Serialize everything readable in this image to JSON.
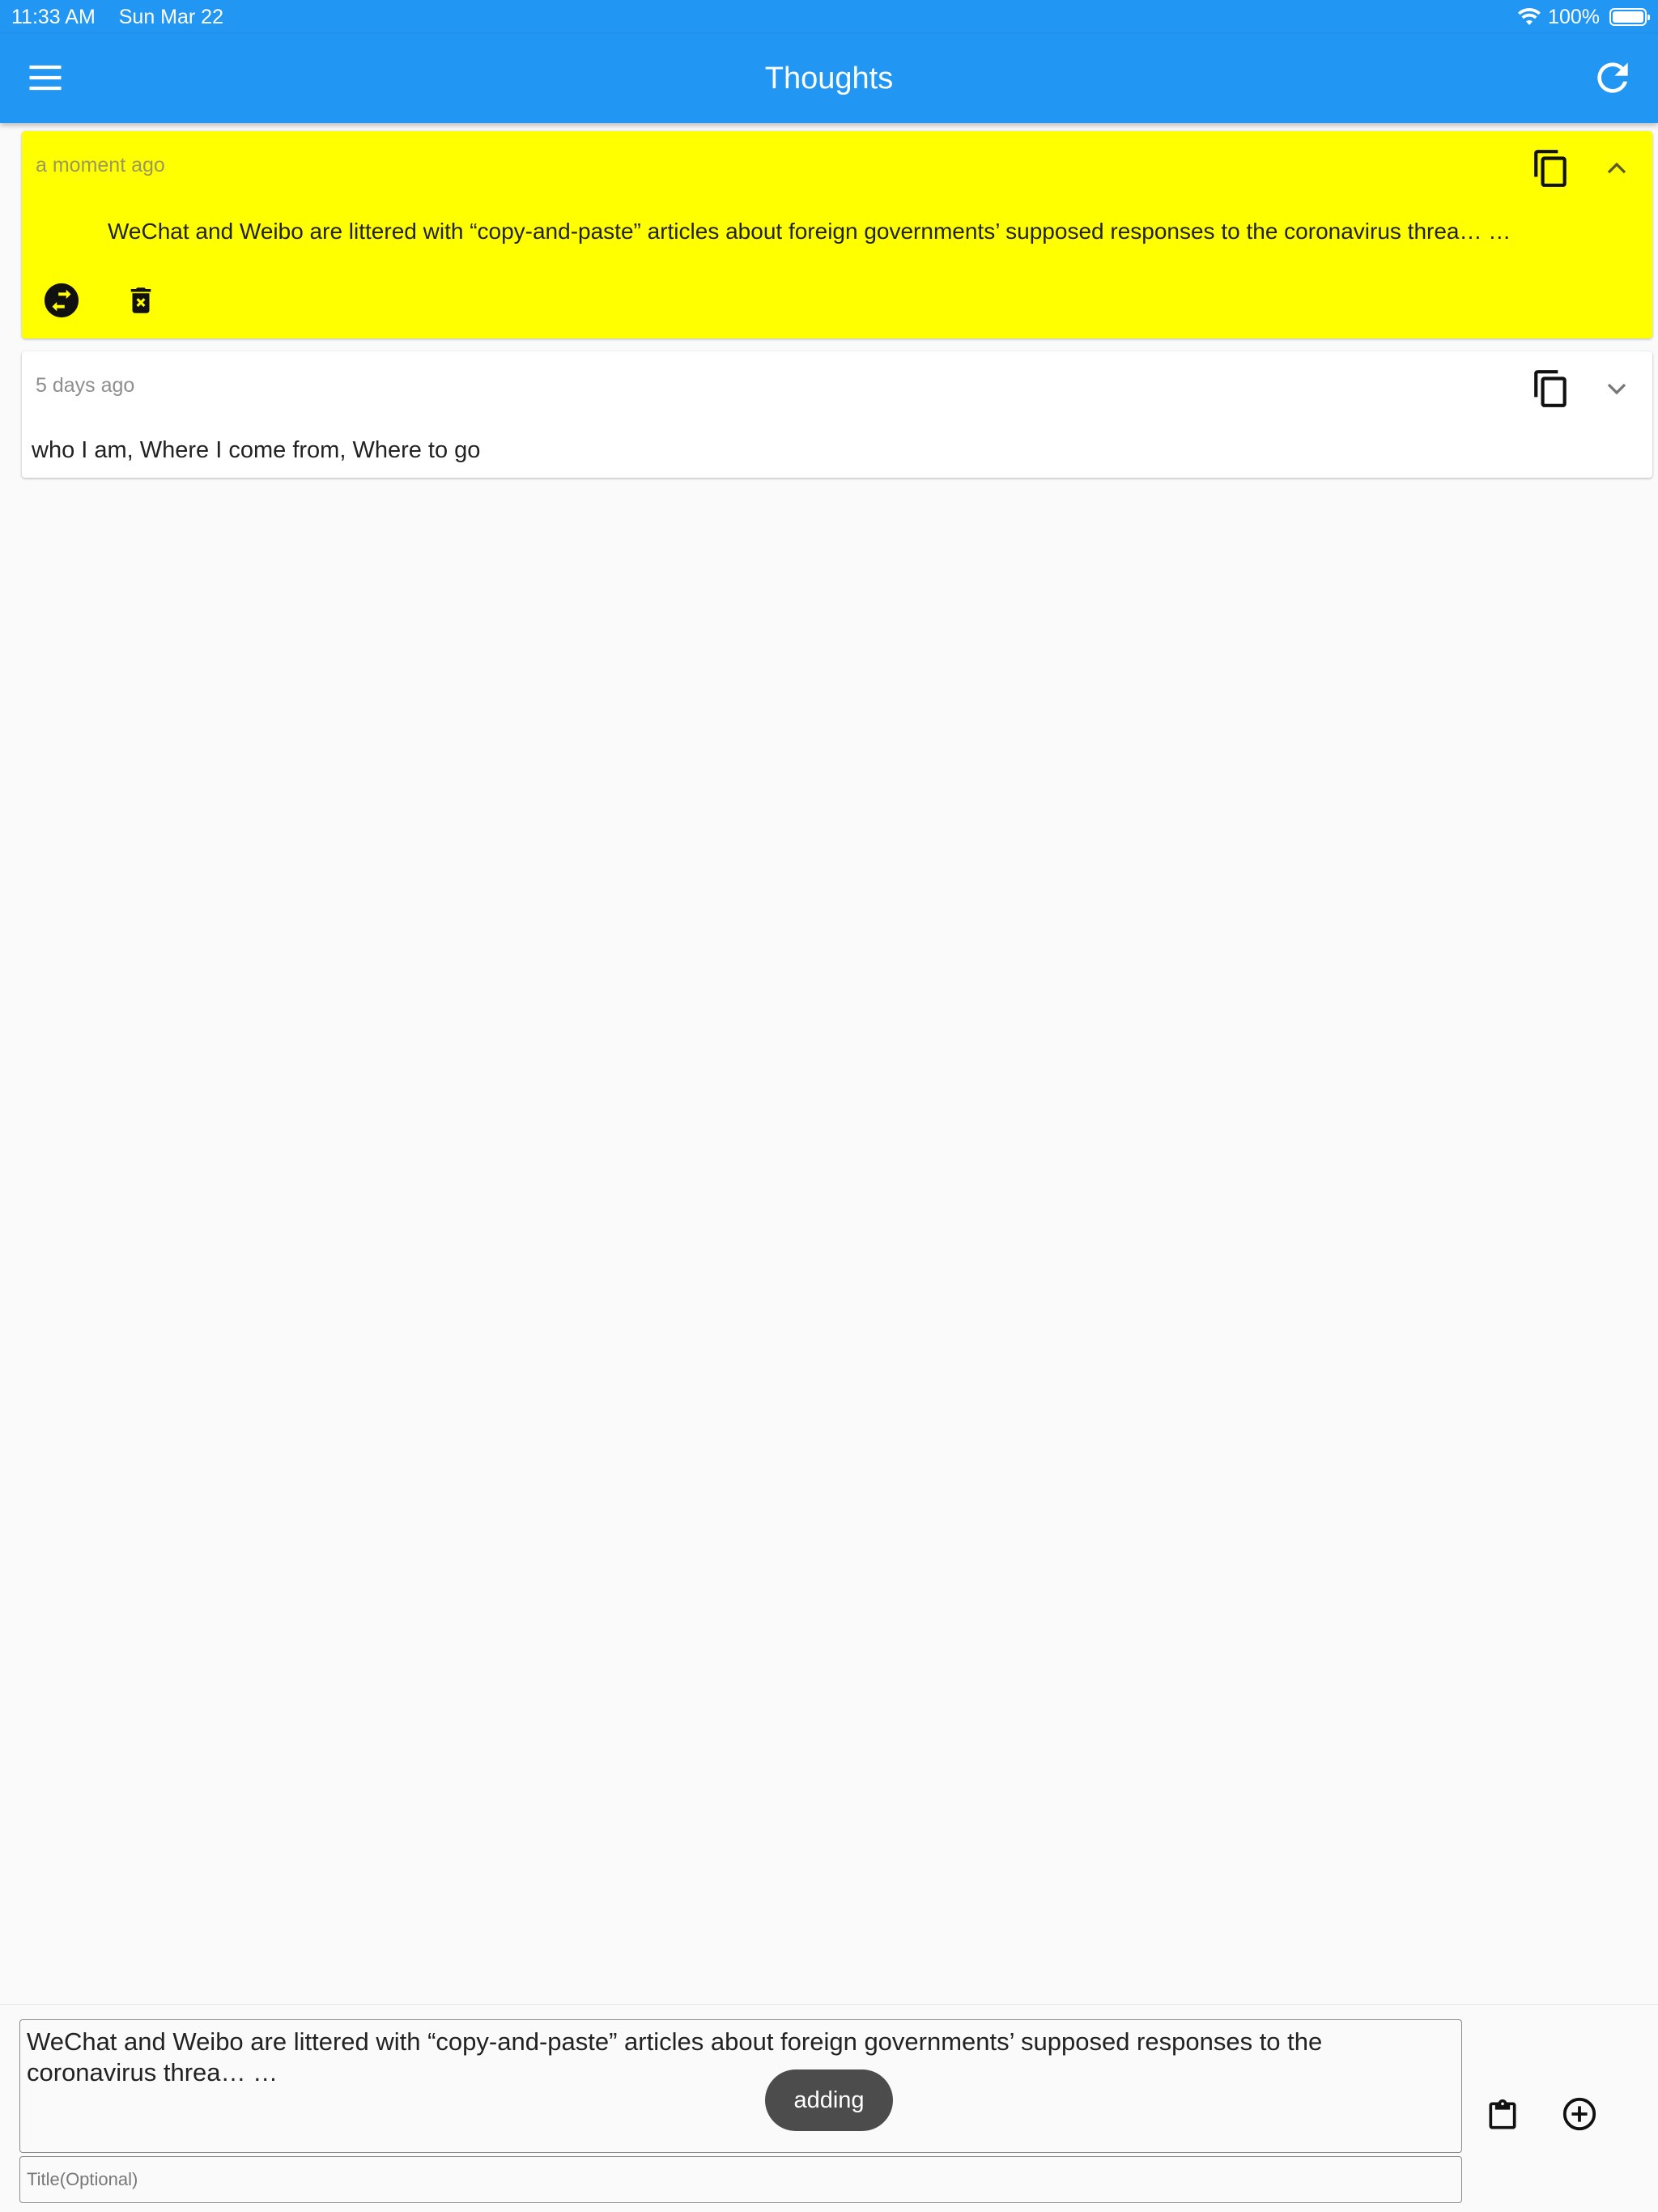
{
  "status_bar": {
    "time": "11:33 AM",
    "date": "Sun Mar 22",
    "battery_percent": "100%",
    "battery_level": 1.0
  },
  "app_bar": {
    "title": "Thoughts",
    "menu_icon": "hamburger-menu-icon",
    "refresh_icon": "refresh-icon",
    "background_color": "#2196f3"
  },
  "thoughts": [
    {
      "time": "a moment ago",
      "text": "WeChat and Weibo are littered with “copy-and-paste” articles about foreign governments’ supposed responses to the coronavirus threa… …",
      "expanded": true,
      "background_color": "#ffff00",
      "actions": [
        "swap-icon",
        "delete-icon"
      ]
    },
    {
      "time": "5 days ago",
      "text": "who I am, Where I come from, Where to go",
      "expanded": false,
      "background_color": "#ffffff"
    }
  ],
  "composer": {
    "content_value": "WeChat and Weibo are littered with “copy-and-paste” articles about foreign governments’ supposed responses to the coronavirus threa… …",
    "title_placeholder": "Title(Optional)",
    "toast": "adding",
    "paste_icon": "clipboard-icon",
    "add_icon": "add-circle-icon"
  }
}
